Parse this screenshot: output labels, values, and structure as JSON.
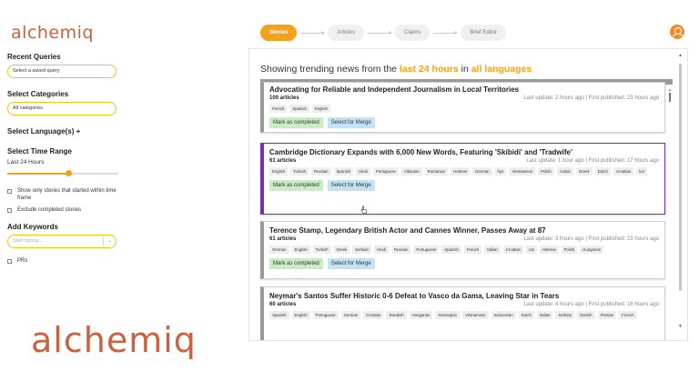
{
  "brand": {
    "logo": "alchemiq",
    "big_logo": "alchemiq"
  },
  "steps": [
    "Stories",
    "Articles",
    "Claims",
    "Brief Editor"
  ],
  "sidebar": {
    "recent_queries_heading": "Recent Queries",
    "recent_queries_value": "Select a saved query",
    "categories_heading": "Select Categories",
    "categories_value": "All categories",
    "languages_heading": "Select Language(s) +",
    "time_heading": "Select Time Range",
    "time_value": "Last 24 Hours",
    "time_slider_fraction": 0.55,
    "checkbox_only_started": "Show only stories that started within time frame",
    "checkbox_exclude_completed": "Exclude completed stories",
    "keywords_heading": "Add Keywords",
    "keywords_placeholder": "Start typing...",
    "checkbox_prs": "PRs"
  },
  "main": {
    "heading_prefix": "Showing trending news from the ",
    "heading_time": "last 24 hours",
    "heading_mid": " in ",
    "heading_lang": "all languages",
    "button_completed": "Mark as completed",
    "button_merge": "Select for Merge",
    "stories": [
      {
        "title": "Advocating for Reliable and Independent Journalism in Local Territories",
        "count": "100 articles",
        "meta": "Last update: 2 hours ago | First published: 23 hours ago",
        "tags": [
          "French",
          "Spanish",
          "English"
        ]
      },
      {
        "title": "Cambridge Dictionary Expands with 6,000 New Words, Featuring 'Skibidi' and 'Tradwife'",
        "count": "61 articles",
        "meta": "Last update: 1 hour ago | First published: 17 hours ago",
        "tags": [
          "English",
          "Turkish",
          "Russian",
          "Spanish",
          "Hindi",
          "Portuguese",
          "Albanian",
          "Romanian",
          "Hebrew",
          "German",
          "hye",
          "Vietnamese",
          "Polish",
          "Arabic",
          "Greek",
          "Dutch",
          "Croatian",
          "kor"
        ]
      },
      {
        "title": "Terence Stamp, Legendary British Actor and Cannes Winner, Passes Away at 87",
        "count": "61 articles",
        "meta": "Last update: 3 hours ago | First published: 23 hours ago",
        "tags": [
          "German",
          "English",
          "Turkish",
          "Greek",
          "Serbian",
          "Hindi",
          "Russian",
          "Portuguese",
          "Spanish",
          "French",
          "Italian",
          "Croatian",
          "cat",
          "Hebrew",
          "Polish",
          "Hungarian"
        ]
      },
      {
        "title": "Neymar's Santos Suffer Historic 0-6 Defeat to Vasco da Gama, Leaving Star in Tears",
        "count": "60 articles",
        "meta": "Last update: 4 hours ago | First published: 16 hours ago",
        "tags": [
          "Spanish",
          "English",
          "Portuguese",
          "German",
          "Croatian",
          "Swedish",
          "Hungarian",
          "Norwegian",
          "Vietnamese",
          "Indonesian",
          "Dutch",
          "Italian",
          "Serbian",
          "Danish",
          "Persian",
          "French"
        ]
      }
    ]
  }
}
